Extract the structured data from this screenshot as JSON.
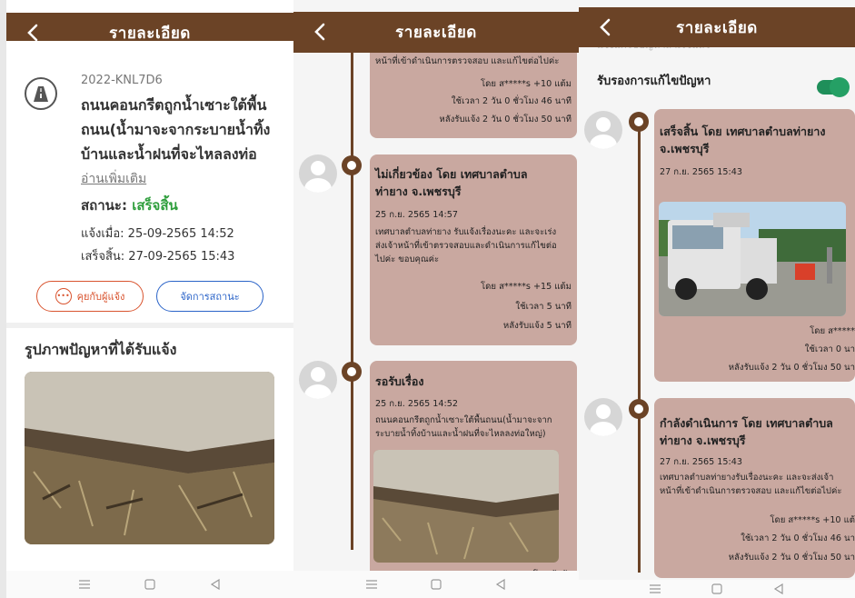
{
  "colors": {
    "brand_brown": "#6b4326",
    "card_bg": "#c9a8a0",
    "status_green": "#2e9e3c",
    "chat_orange": "#d9542f",
    "manage_blue": "#2a63c8",
    "toggle_green": "#25a065"
  },
  "header": {
    "title": "รายละเอียด",
    "back_icon": "chevron-left-icon"
  },
  "screen1": {
    "ticket_code": "2022-KNL7D6",
    "topic_lines": [
      "ถนนคอนกรีตถูกน้ำเซาะใต้พื้น",
      "ถนน(น้ำมาจะจากระบายน้ำทิ้ง",
      "บ้านและน้ำฝนที่จะไหลลงท่อ"
    ],
    "read_more": "อ่านเพิ่มเติม",
    "status_label": "สถานะ:",
    "status_value": "เสร็จสิ้น",
    "reported_at": "แจ้งเมื่อ: 25-09-2565 14:52",
    "finished_at": "เสร็จสิ้น: 27-09-2565 15:43",
    "chat_button": "คุยกับผู้แจ้ง",
    "manage_button": "จัดการสถานะ",
    "photo_section_title": "รูปภาพปัญหาที่ได้รับแจ้ง"
  },
  "screen2": {
    "card_top": {
      "partial_text": "หน้าที่เข้าดำเนินการตรวจสอบ และแก้ไขต่อไปค่ะ",
      "by_line": "โดย ส*****s +10 แต้ม",
      "used_time": "ใช้เวลา 2 วัน 0 ชั่วโมง 46 นาที",
      "after_report": "หลังรับแจ้ง 2 วัน 0 ชั่วโมง 50 นาที"
    },
    "card_irrelevant": {
      "title_lines": [
        "ไม่เกี่ยวข้อง โดย  เทศบาลตำบล",
        "ท่ายาง จ.เพชรบุรี"
      ],
      "date": "25 ก.ย. 2565 14:57",
      "desc_lines": [
        "เทศบาลตำบลท่ายาง รับแจ้งเรื่องนะคะ และจะเร่ง",
        "ส่งเจ้าหน้าที่เข้าตรวจสอบและดำเนินการแก้ไขต่อ",
        "ไปค่ะ  ขอบคุณค่ะ"
      ],
      "by_line": "โดย ส*****s +15 แต้ม",
      "used_time": "ใช้เวลา 5 นาที",
      "after_report": "หลังรับแจ้ง 5 นาที"
    },
    "card_waiting": {
      "title": "รอรับเรื่อง",
      "date": "25 ก.ย. 2565 14:52",
      "desc_lines": [
        "ถนนคอนกรีตถูกน้ำเซาะใต้พื้นถนน(น้ำมาจะจาก",
        "ระบายน้ำทิ้งบ้านและน้ำฝนที่จะไหลลงท่อใหญ่)"
      ],
      "by_line": "โดย ผู้แจ้ง"
    }
  },
  "screen3": {
    "partial_header": "แจ้งแก้ไขปัญหาสำเร็จแล้ว",
    "approve_label": "รับรองการแก้ไขปัญหา",
    "card_done": {
      "title_lines": [
        "เสร็จสิ้น โดย  เทศบาลตำบลท่ายาง",
        "จ.เพชรบุรี"
      ],
      "date": "27 ก.ย. 2565 15:43",
      "by_line": "โดย ส*****",
      "used_time": "ใช้เวลา 0 นา",
      "after_report": "หลังรับแจ้ง 2 วัน 0 ชั่วโมง 50 นา"
    },
    "card_progress": {
      "title_lines": [
        "กำลังดำเนินการ โดย  เทศบาลตำบล",
        "ท่ายาง จ.เพชรบุรี"
      ],
      "date": "27 ก.ย. 2565 15:43",
      "desc_lines": [
        "เทศบาลตำบลท่ายางรับเรื่องนะคะ  และจะส่งเจ้า",
        "หน้าที่เข้าดำเนินการตรวจสอบ และแก้ไขต่อไปค่ะ"
      ],
      "by_line": "โดย ส*****s +10 แต้",
      "used_time": "ใช้เวลา 2 วัน 0 ชั่วโมง 46 นา",
      "after_report": "หลังรับแจ้ง 2 วัน 0 ชั่วโมง 50 นา"
    }
  },
  "navbar": {
    "icons": [
      "menu-icon",
      "home-square-icon",
      "back-triangle-icon"
    ]
  }
}
